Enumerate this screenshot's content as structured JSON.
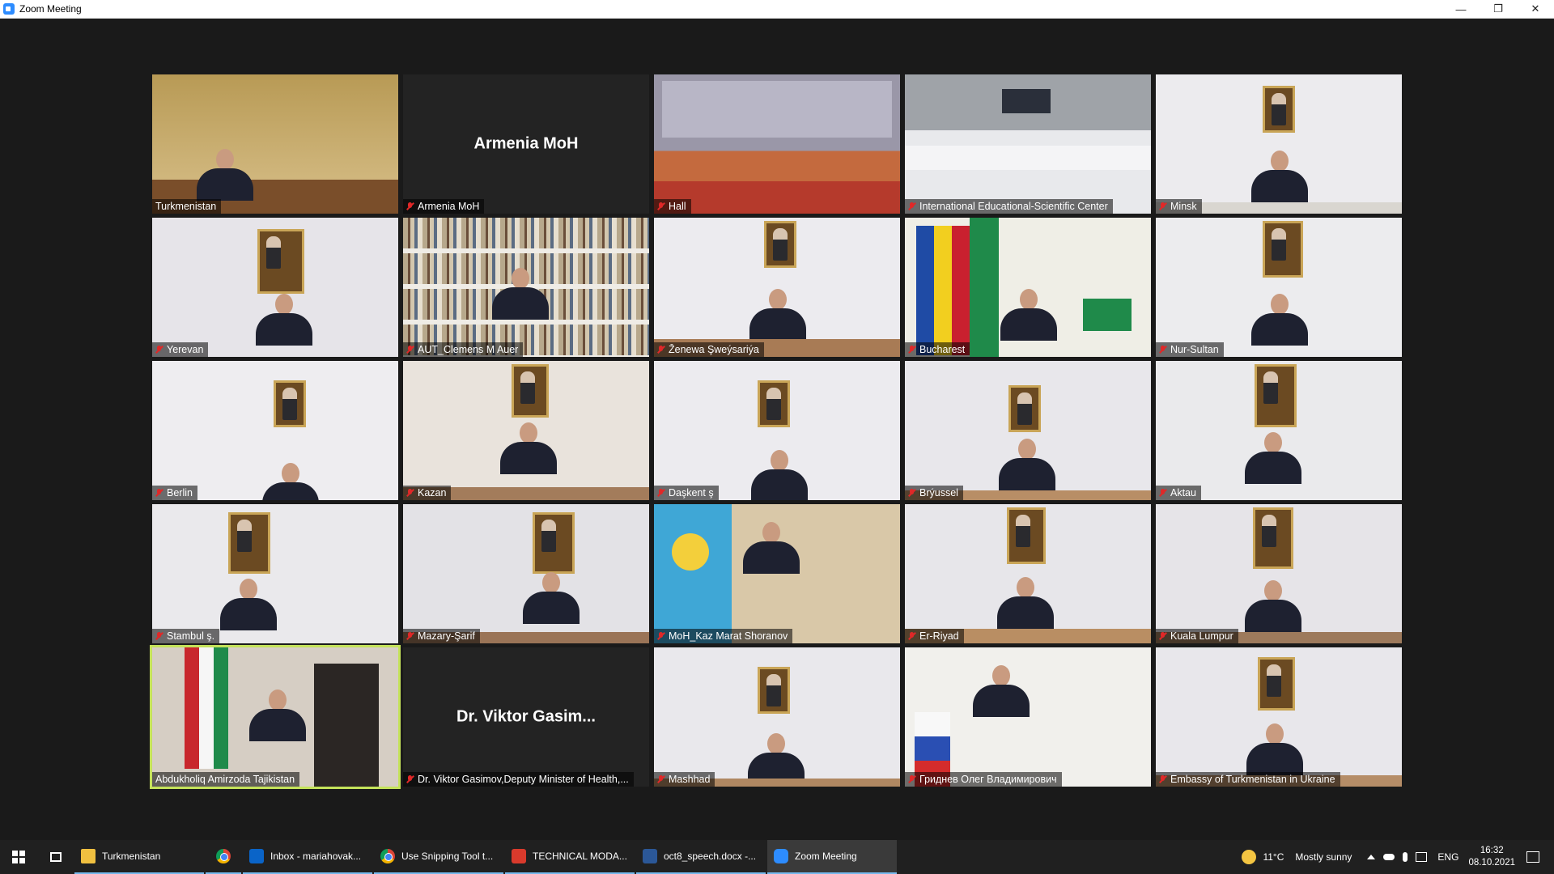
{
  "window": {
    "title": "Zoom Meeting",
    "controls": {
      "minimize": "—",
      "restore": "❐",
      "close": "✕"
    }
  },
  "tiles": [
    {
      "label": "Turkmenistan",
      "muted": false
    },
    {
      "label": "Armenia MoH",
      "muted": true,
      "display_name": "Armenia MoH"
    },
    {
      "label": "Hall",
      "muted": true
    },
    {
      "label": "International Educational-Scientific Center",
      "muted": true
    },
    {
      "label": "Minsk",
      "muted": true
    },
    {
      "label": "Yerevan",
      "muted": true
    },
    {
      "label": "AUT_Clemens M Auer",
      "muted": true
    },
    {
      "label": "Ženewa Şweýsariýa",
      "muted": true
    },
    {
      "label": "Bucharest",
      "muted": true
    },
    {
      "label": "Nur-Sultan",
      "muted": true
    },
    {
      "label": "Berlin",
      "muted": true
    },
    {
      "label": "Kazan",
      "muted": true
    },
    {
      "label": "Daşkent ş",
      "muted": true
    },
    {
      "label": "Brýussel",
      "muted": true
    },
    {
      "label": "Aktau",
      "muted": true
    },
    {
      "label": "Stambul ş.",
      "muted": true
    },
    {
      "label": "Mazary-Şarif",
      "muted": true
    },
    {
      "label": "MoH_Kaz Marat Shoranov",
      "muted": true
    },
    {
      "label": "Er-Riyad",
      "muted": true
    },
    {
      "label": "Kuala Lumpur",
      "muted": true
    },
    {
      "label": "Abdukholiq Amirzoda Tajikistan",
      "muted": false,
      "active_speaker": true
    },
    {
      "label": "Dr. Viktor Gasimov,Deputy Minister of Health,...",
      "muted": true,
      "display_name": "Dr. Viktor Gasim..."
    },
    {
      "label": "Mashhad",
      "muted": true
    },
    {
      "label": "Гриднев Олег Владимирович",
      "muted": true
    },
    {
      "label": "Embassy of Turkmenistan in Ukraine",
      "muted": true
    }
  ],
  "taskbar": {
    "items": [
      {
        "label": "Turkmenistan",
        "icon": "folder-icon"
      },
      {
        "label": "",
        "icon": "chrome-icon"
      },
      {
        "label": "Inbox - mariahovak...",
        "icon": "outlook-icon"
      },
      {
        "label": "Use Snipping Tool t...",
        "icon": "chrome-icon"
      },
      {
        "label": "TECHNICAL MODA...",
        "icon": "pdf-icon"
      },
      {
        "label": "oct8_speech.docx -...",
        "icon": "word-icon"
      },
      {
        "label": "Zoom Meeting",
        "icon": "zoom-icon",
        "active": true
      }
    ],
    "weather": {
      "temp": "11°C",
      "condition": "Mostly sunny"
    },
    "language": "ENG",
    "time": "16:32",
    "date": "08.10.2021"
  },
  "colors": {
    "meeting_bg": "#1a1a1a",
    "active_speaker_border": "#c4e25a",
    "muted_mic": "#e02828",
    "taskbar_bg": "#202020"
  }
}
